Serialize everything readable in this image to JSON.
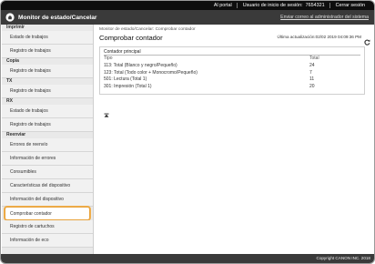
{
  "topbar": {
    "portal_label": "Al portal",
    "login_user_label": "Usuario de inicio de sesión:",
    "login_user_value": "7654321",
    "logout_label": "Cerrar sesión"
  },
  "titlebar": {
    "title": "Monitor de estado/Cancelar",
    "mail_link": "Enviar correo al administrador del sistema",
    "home_icon": "home-icon"
  },
  "sidebar": {
    "sections": [
      {
        "head": "Imprimir",
        "items": [
          "Estado de trabajos",
          "Registro de trabajos"
        ]
      },
      {
        "head": "Copia",
        "items": [
          "Registro de trabajos"
        ]
      },
      {
        "head": "TX",
        "items": [
          "Registro de trabajos"
        ]
      },
      {
        "head": "RX",
        "items": [
          "Estado de trabajos",
          "Registro de trabajos"
        ]
      },
      {
        "head": "Reenviar",
        "items": [
          "Errores de reenvío",
          "Información de errores",
          "Consumibles",
          "Características del dispositivo",
          "Información del dispositivo",
          "Comprobar contador",
          "Registro de cartuchos",
          "Información de eco"
        ]
      }
    ],
    "active_item": "Comprobar contador"
  },
  "main": {
    "breadcrumb": "Monitor de estado/Cancelar: Comprobar contador",
    "title": "Comprobar contador",
    "updated": "Última actualización:02/02 2019 04:09:36 PM",
    "panel_title": "Contador principal",
    "columns": [
      "Tipo",
      "Total"
    ],
    "rows": [
      {
        "type": "113: Total (Blanco y negro/Pequeño)",
        "total": "24"
      },
      {
        "type": "123: Total (Todo color + Monocromo/Pequeño)",
        "total": "7"
      },
      {
        "type": "501: Lectura (Total 1)",
        "total": "11"
      },
      {
        "type": "301: Impresión (Total 1)",
        "total": "20"
      }
    ]
  },
  "footer": {
    "copyright": "Copyright CANON INC. 2018"
  },
  "colors": {
    "topbar": "#0e0e0e",
    "titlebar": "#3a3a3a",
    "highlight": "#e8a23a",
    "sidebar": "#e9e9e9"
  }
}
